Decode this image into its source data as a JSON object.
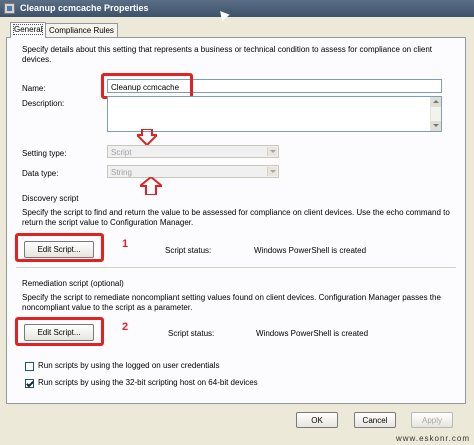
{
  "window": {
    "title": "Cleanup ccmcache Properties"
  },
  "tabs": [
    {
      "label": "General",
      "active": true
    },
    {
      "label": "Compliance Rules",
      "active": false
    }
  ],
  "intro_text": "Specify details about this setting that represents a business or technical condition to assess for compliance on client devices.",
  "name_field": {
    "label": "Name:",
    "value": "Cleanup ccmcache"
  },
  "description_field": {
    "label": "Description:",
    "value": ""
  },
  "setting_type": {
    "label": "Setting type:",
    "value": "Script"
  },
  "data_type": {
    "label": "Data type:",
    "value": "String"
  },
  "discovery": {
    "heading": "Discovery script",
    "text": "Specify the script to find and return the value to be assessed for compliance on client devices. Use the echo command to return the script value to Configuration Manager.",
    "button": "Edit Script...",
    "status_label": "Script status:",
    "status_value": "Windows PowerShell is created",
    "annotation": "1"
  },
  "remediation": {
    "heading": "Remediation script (optional)",
    "text": "Specify the script to remediate noncompliant setting values found on client devices. Configuration Manager passes the noncompliant value to the script as a parameter.",
    "button": "Edit Script...",
    "status_label": "Script status:",
    "status_value": "Windows PowerShell is created",
    "annotation": "2"
  },
  "options": {
    "logged_on_credentials": {
      "label": "Run scripts by using the logged on user credentials",
      "checked": false
    },
    "use_32bit_host": {
      "label": "Run scripts by using the 32-bit scripting host on 64-bit devices",
      "checked": true
    }
  },
  "footer": {
    "ok": "OK",
    "cancel": "Cancel",
    "apply": "Apply"
  },
  "watermark": "www.eskonr.com",
  "colors": {
    "annotation_red": "#e02222",
    "titlebar": "#4a5f78"
  }
}
